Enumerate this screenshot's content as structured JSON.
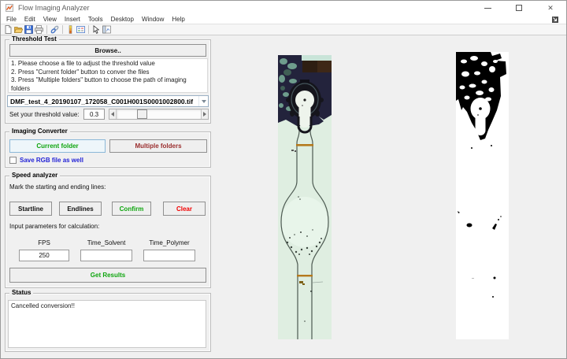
{
  "window": {
    "title": "Flow Imaging Analyzer"
  },
  "menu": {
    "items": [
      "File",
      "Edit",
      "View",
      "Insert",
      "Tools",
      "Desktop",
      "Window",
      "Help"
    ]
  },
  "toolbar": {
    "icons": [
      "new-file-icon",
      "open-file-icon",
      "save-figure-icon",
      "print-figure-icon",
      "link-plot-icon",
      "insert-colorbar-icon",
      "insert-legend-icon",
      "edit-plot-icon",
      "plot-browser-icon"
    ]
  },
  "threshold_test": {
    "title": "Threshold Test",
    "browse_label": "Browse..",
    "instructions": [
      "1. Please choose a file to adjust the threshold value",
      "2. Press \"Current folder\" button to conver the files",
      "3. Press \"Multiple folders\" button to choose the path of imaging folders"
    ],
    "file_dropdown_value": "DMF_test_4_20190107_172058_C001H001S0001002800.tif",
    "threshold_label": "Set your threshold value:",
    "threshold_value": "0.3",
    "slider_percent": 30
  },
  "imaging_converter": {
    "title": "Imaging Converter",
    "current_folder_label": "Current folder",
    "multiple_folders_label": "Multiple folders",
    "save_rgb_label": "Save RGB file as well",
    "save_rgb_checked": false
  },
  "speed_analyzer": {
    "title": "Speed analyzer",
    "mark_label": "Mark the starting and ending lines:",
    "startline_label": "Startline",
    "endlines_label": "Endlines",
    "confirm_label": "Confirm",
    "clear_label": "Clear",
    "params_label": "Input parameters for calculation:",
    "fields": [
      {
        "label": "FPS",
        "value": "250"
      },
      {
        "label": "Time_Solvent",
        "value": ""
      },
      {
        "label": "Time_Polymer",
        "value": ""
      }
    ],
    "get_results_label": "Get Results"
  },
  "status": {
    "title": "Status",
    "message": "Cancelled conversion!!"
  },
  "colors": {
    "action_green": "#0ea50e",
    "action_red": "#f20000",
    "dark_red": "#9a2d2d",
    "link_blue": "#2323d6",
    "orange_marker": "#b5791c"
  }
}
